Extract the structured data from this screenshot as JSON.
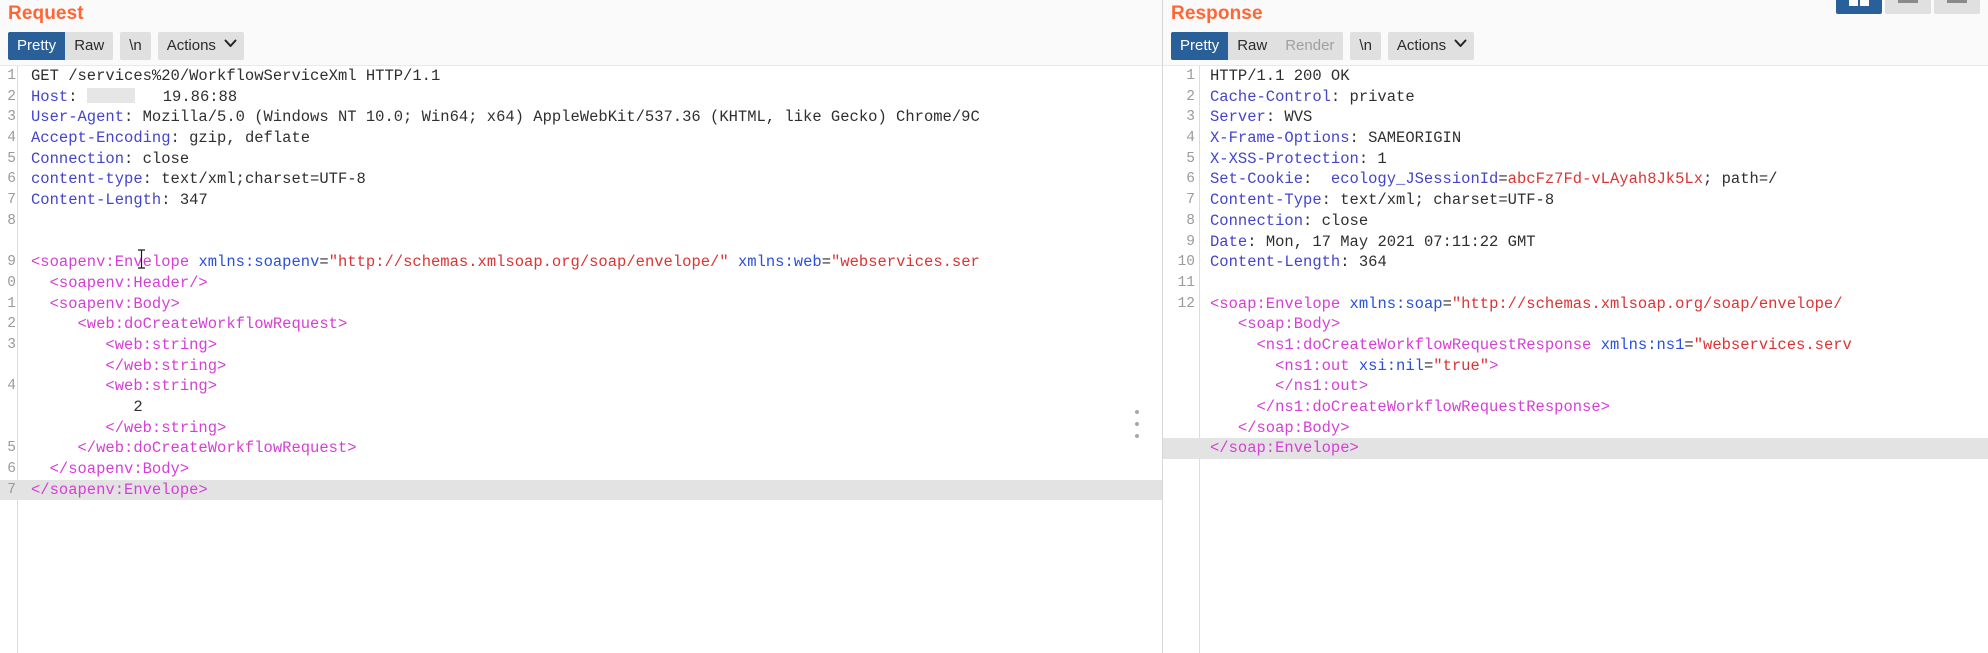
{
  "window_controls": [
    {
      "name": "layout-tabs-button",
      "state": "active"
    },
    {
      "name": "layout-horizontal-button",
      "state": "inactive"
    },
    {
      "name": "layout-vertical-button",
      "state": "inactive"
    }
  ],
  "request": {
    "title": "Request",
    "toolbar": {
      "pretty": "Pretty",
      "raw": "Raw",
      "newline": "\\n",
      "actions": "Actions",
      "selected": "Pretty"
    },
    "lines": [
      {
        "n": "1",
        "segments": [
          {
            "t": "GET /services%20/WorkflowServiceXml HTTP/1.1",
            "c": "k-plain"
          }
        ]
      },
      {
        "n": "2",
        "segments": [
          {
            "t": "Host",
            "c": "k-hdr"
          },
          {
            "t": ": ",
            "c": "k-plain"
          },
          {
            "t": "",
            "c": "redact"
          },
          {
            "t": "   19.86:88",
            "c": "k-plain"
          }
        ]
      },
      {
        "n": "3",
        "segments": [
          {
            "t": "User-Agent",
            "c": "k-hdr"
          },
          {
            "t": ": Mozilla/5.0 (Windows NT 10.0; Win64; x64) AppleWebKit/537.36 (KHTML, like Gecko) Chrome/9C",
            "c": "k-plain"
          }
        ]
      },
      {
        "n": "4",
        "segments": [
          {
            "t": "Accept-Encoding",
            "c": "k-hdr"
          },
          {
            "t": ": gzip, deflate",
            "c": "k-plain"
          }
        ]
      },
      {
        "n": "5",
        "segments": [
          {
            "t": "Connection",
            "c": "k-hdr"
          },
          {
            "t": ": close",
            "c": "k-plain"
          }
        ]
      },
      {
        "n": "6",
        "segments": [
          {
            "t": "content-type",
            "c": "k-hdr"
          },
          {
            "t": ": text/xml;charset=UTF-8",
            "c": "k-plain"
          }
        ]
      },
      {
        "n": "7",
        "segments": [
          {
            "t": "Content-Length",
            "c": "k-hdr"
          },
          {
            "t": ": 347",
            "c": "k-plain"
          }
        ]
      },
      {
        "n": "8",
        "segments": []
      },
      {
        "n": "",
        "segments": []
      },
      {
        "n": "9",
        "segments": [
          {
            "t": "<soapenv:Envelope",
            "c": "k-tag"
          },
          {
            "t": " ",
            "c": "k-plain"
          },
          {
            "t": "xmlns:soapenv",
            "c": "k-attr"
          },
          {
            "t": "=",
            "c": "k-plain"
          },
          {
            "t": "\"http://schemas.xmlsoap.org/soap/envelope/\"",
            "c": "k-str"
          },
          {
            "t": " ",
            "c": "k-plain"
          },
          {
            "t": "xmlns:web",
            "c": "k-attr"
          },
          {
            "t": "=",
            "c": "k-plain"
          },
          {
            "t": "\"webservices.ser",
            "c": "k-str"
          }
        ]
      },
      {
        "n": "0",
        "segments": [
          {
            "t": "  <soapenv:Header/>",
            "c": "k-tag"
          }
        ]
      },
      {
        "n": "1",
        "segments": [
          {
            "t": "  <soapenv:Body>",
            "c": "k-tag"
          }
        ]
      },
      {
        "n": "2",
        "segments": [
          {
            "t": "     <web:doCreateWorkflowRequest>",
            "c": "k-tag"
          }
        ]
      },
      {
        "n": "3",
        "segments": [
          {
            "t": "        <web:string>",
            "c": "k-tag"
          }
        ]
      },
      {
        "n": "",
        "segments": [
          {
            "t": "        </web:string>",
            "c": "k-tag"
          }
        ]
      },
      {
        "n": "4",
        "segments": [
          {
            "t": "        <web:string>",
            "c": "k-tag"
          }
        ]
      },
      {
        "n": "",
        "segments": [
          {
            "t": "           2",
            "c": "k-plain"
          }
        ]
      },
      {
        "n": "",
        "segments": [
          {
            "t": "        </web:string>",
            "c": "k-tag"
          }
        ]
      },
      {
        "n": "5",
        "segments": [
          {
            "t": "     </web:doCreateWorkflowRequest>",
            "c": "k-tag"
          }
        ]
      },
      {
        "n": "6",
        "segments": [
          {
            "t": "  </soapenv:Body>",
            "c": "k-tag"
          }
        ]
      },
      {
        "n": "7",
        "segments": [
          {
            "t": "</soapenv:Envelope>",
            "c": "k-tag"
          }
        ],
        "highlight": true
      }
    ]
  },
  "response": {
    "title": "Response",
    "toolbar": {
      "pretty": "Pretty",
      "raw": "Raw",
      "render": "Render",
      "newline": "\\n",
      "actions": "Actions",
      "selected": "Pretty",
      "disabled": "Render"
    },
    "lines": [
      {
        "n": "1",
        "segments": [
          {
            "t": "HTTP/1.1 200 OK",
            "c": "k-plain"
          }
        ]
      },
      {
        "n": "2",
        "segments": [
          {
            "t": "Cache-Control",
            "c": "k-hdr"
          },
          {
            "t": ": private",
            "c": "k-plain"
          }
        ]
      },
      {
        "n": "3",
        "segments": [
          {
            "t": "Server",
            "c": "k-hdr"
          },
          {
            "t": ": WVS",
            "c": "k-plain"
          }
        ]
      },
      {
        "n": "4",
        "segments": [
          {
            "t": "X-Frame-Options",
            "c": "k-hdr"
          },
          {
            "t": ": SAMEORIGIN",
            "c": "k-plain"
          }
        ]
      },
      {
        "n": "5",
        "segments": [
          {
            "t": "X-XSS-Protection",
            "c": "k-hdr"
          },
          {
            "t": ": 1",
            "c": "k-plain"
          }
        ]
      },
      {
        "n": "6",
        "segments": [
          {
            "t": "Set-Cookie",
            "c": "k-hdr"
          },
          {
            "t": ":  ",
            "c": "k-plain"
          },
          {
            "t": "ecology_JSessionId",
            "c": "k-hdr"
          },
          {
            "t": "=",
            "c": "k-plain"
          },
          {
            "t": "abcFz7Fd-vLAyah8Jk5Lx",
            "c": "k-str"
          },
          {
            "t": "; path=/",
            "c": "k-plain"
          }
        ]
      },
      {
        "n": "7",
        "segments": [
          {
            "t": "Content-Type",
            "c": "k-hdr"
          },
          {
            "t": ": text/xml; charset=UTF-8",
            "c": "k-plain"
          }
        ]
      },
      {
        "n": "8",
        "segments": [
          {
            "t": "Connection",
            "c": "k-hdr"
          },
          {
            "t": ": close",
            "c": "k-plain"
          }
        ]
      },
      {
        "n": "9",
        "segments": [
          {
            "t": "Date",
            "c": "k-hdr"
          },
          {
            "t": ": Mon, 17 May 2021 07:11:22 GMT",
            "c": "k-plain"
          }
        ]
      },
      {
        "n": "10",
        "segments": [
          {
            "t": "Content-Length",
            "c": "k-hdr"
          },
          {
            "t": ": 364",
            "c": "k-plain"
          }
        ]
      },
      {
        "n": "11",
        "segments": []
      },
      {
        "n": "12",
        "segments": [
          {
            "t": "<soap:Envelope",
            "c": "k-tag"
          },
          {
            "t": " ",
            "c": "k-plain"
          },
          {
            "t": "xmlns:soap",
            "c": "k-attr"
          },
          {
            "t": "=",
            "c": "k-plain"
          },
          {
            "t": "\"http://schemas.xmlsoap.org/soap/envelope/",
            "c": "k-str"
          }
        ]
      },
      {
        "n": "",
        "segments": [
          {
            "t": "   <soap:Body>",
            "c": "k-tag"
          }
        ]
      },
      {
        "n": "",
        "segments": [
          {
            "t": "     <ns1:doCreateWorkflowRequestResponse",
            "c": "k-tag"
          },
          {
            "t": " ",
            "c": "k-plain"
          },
          {
            "t": "xmlns:ns1",
            "c": "k-attr"
          },
          {
            "t": "=",
            "c": "k-plain"
          },
          {
            "t": "\"webservices.serv",
            "c": "k-str"
          }
        ]
      },
      {
        "n": "",
        "segments": [
          {
            "t": "       <ns1:out",
            "c": "k-tag"
          },
          {
            "t": " ",
            "c": "k-plain"
          },
          {
            "t": "xsi:nil",
            "c": "k-attr"
          },
          {
            "t": "=",
            "c": "k-plain"
          },
          {
            "t": "\"true\"",
            "c": "k-str"
          },
          {
            "t": ">",
            "c": "k-tag"
          }
        ]
      },
      {
        "n": "",
        "segments": [
          {
            "t": "       </ns1:out>",
            "c": "k-tag"
          }
        ]
      },
      {
        "n": "",
        "segments": [
          {
            "t": "     </ns1:doCreateWorkflowRequestResponse>",
            "c": "k-tag"
          }
        ]
      },
      {
        "n": "",
        "segments": [
          {
            "t": "   </soap:Body>",
            "c": "k-tag"
          }
        ]
      },
      {
        "n": "",
        "segments": [
          {
            "t": "</soap:Envelope>",
            "c": "k-tag"
          }
        ],
        "highlight": true
      }
    ]
  }
}
